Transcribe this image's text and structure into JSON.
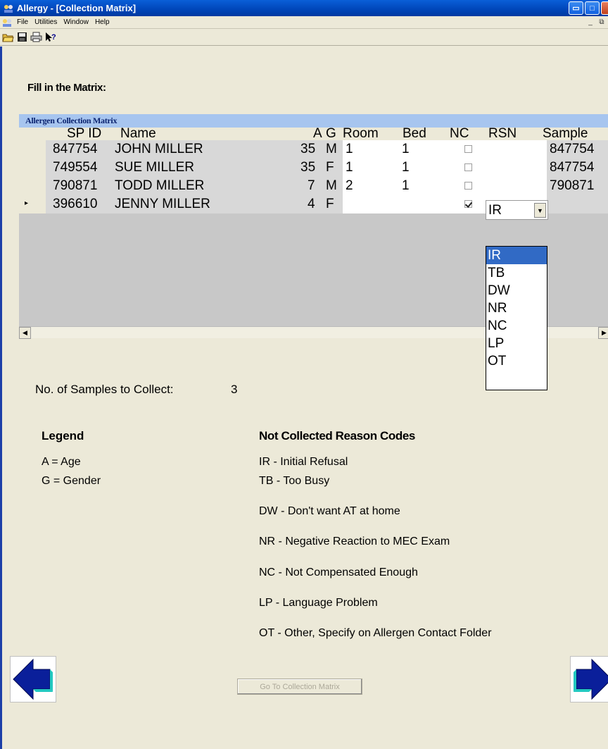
{
  "window": {
    "title": "Allergy - [Collection Matrix]"
  },
  "menu": {
    "items": [
      "File",
      "Utilities",
      "Window",
      "Help"
    ]
  },
  "toolbar": {
    "buttons": [
      "open-folder-icon",
      "save-icon",
      "print-icon",
      "help-pointer-icon"
    ]
  },
  "instruction": "Fill in the Matrix:",
  "grid": {
    "caption": "Allergen Collection Matrix",
    "columns": [
      "SP ID",
      "Name",
      "A",
      "G",
      "Room",
      "Bed",
      "NC",
      "RSN",
      "Sample"
    ],
    "rows": [
      {
        "sp_id": "847754",
        "name": "JOHN MILLER",
        "age": "35",
        "gender": "M",
        "room": "1",
        "bed": "1",
        "nc": false,
        "rsn": "",
        "sample": "847754"
      },
      {
        "sp_id": "749554",
        "name": "SUE MILLER",
        "age": "35",
        "gender": "F",
        "room": "1",
        "bed": "1",
        "nc": false,
        "rsn": "",
        "sample": "847754"
      },
      {
        "sp_id": "790871",
        "name": "TODD MILLER",
        "age": "7",
        "gender": "M",
        "room": "2",
        "bed": "1",
        "nc": false,
        "rsn": "",
        "sample": "790871"
      },
      {
        "sp_id": "396610",
        "name": "JENNY MILLER",
        "age": "4",
        "gender": "F",
        "room": "",
        "bed": "",
        "nc": true,
        "rsn": "IR",
        "sample": ""
      }
    ],
    "current_row_indicator": "▸"
  },
  "rsn_dropdown": {
    "selected": "IR",
    "options": [
      "IR",
      "TB",
      "DW",
      "NR",
      "NC",
      "LP",
      "OT"
    ]
  },
  "samples": {
    "label": "No. of Samples to Collect:",
    "value": "3"
  },
  "legend": {
    "title": "Legend",
    "items": [
      "A = Age",
      "G = Gender"
    ]
  },
  "reason_codes": {
    "title": "Not Collected Reason Codes",
    "items": [
      "IR - Initial Refusal",
      "TB - Too Busy",
      "DW - Don't want AT at home",
      "NR - Negative Reaction to MEC Exam",
      "NC - Not Compensated Enough",
      "LP - Language Problem",
      "OT - Other, Specify on Allergen Contact Folder"
    ]
  },
  "footer": {
    "goto_label": "Go To Collection Matrix"
  }
}
